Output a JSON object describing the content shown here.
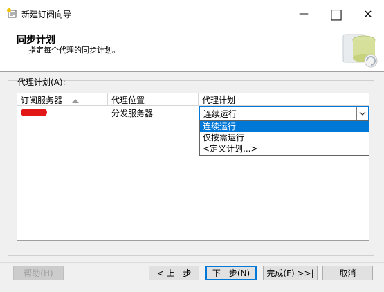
{
  "window": {
    "title": "新建订阅向导",
    "minimize_glyph": "—",
    "maximize_glyph": "□",
    "close_glyph": "✕"
  },
  "header": {
    "title": "同步计划",
    "subtitle": "指定每个代理的同步计划。",
    "art_icon": "database-schedule-icon"
  },
  "agent_schedule": {
    "label": "代理计划(A):",
    "columns": [
      "订阅服务器",
      "代理位置",
      "代理计划"
    ],
    "sort_column": 0,
    "rows": [
      {
        "subscriber": "",
        "subscriber_redacted": true,
        "location": "分发服务器",
        "schedule": "连续运行"
      }
    ],
    "dropdown": {
      "selected": "连续运行",
      "options": [
        "连续运行",
        "仅按需运行",
        "<定义计划...>"
      ],
      "highlighted_index": 0
    }
  },
  "buttons": {
    "help": "帮助(H)",
    "back": "< 上一步",
    "next": "下一步(N)",
    "finish": "完成(F) >>|",
    "cancel": "取消"
  },
  "colors": {
    "accent": "#0078d7",
    "redaction": "#e21818"
  }
}
